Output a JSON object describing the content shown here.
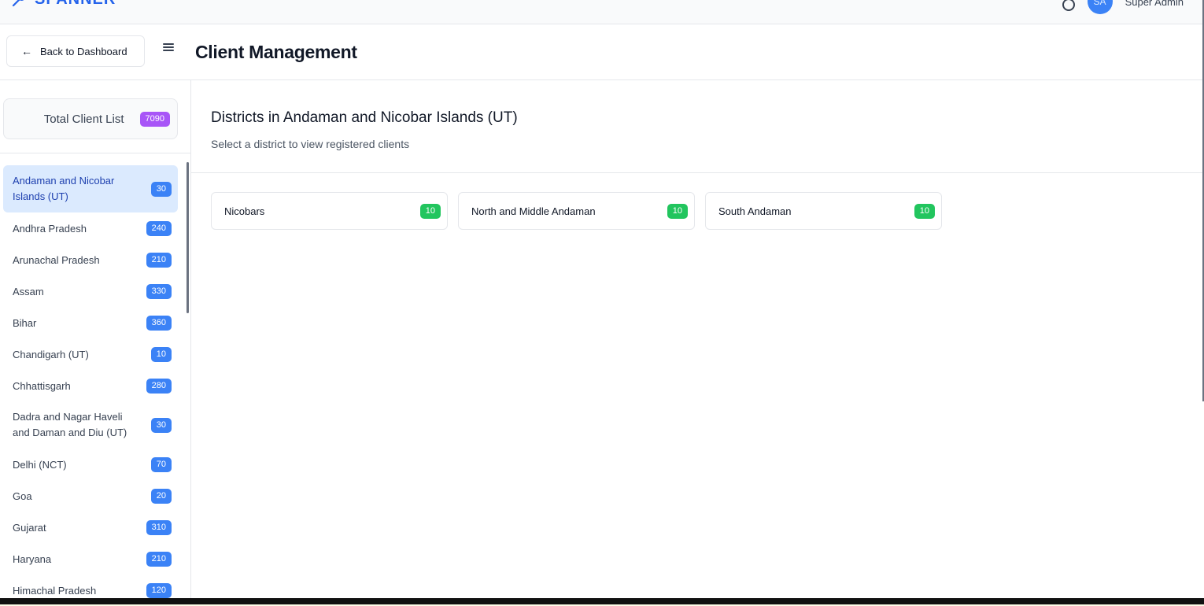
{
  "app": {
    "brand": "SPANNER",
    "user_initials": "SA",
    "user_name": "Super Admin"
  },
  "header": {
    "back_label": "Back to Dashboard",
    "title": "Client Management"
  },
  "sidebar": {
    "total_label": "Total Client List",
    "total_count": "7090",
    "states": [
      {
        "name": "Andaman and Nicobar Islands (UT)",
        "count": "30",
        "active": true
      },
      {
        "name": "Andhra Pradesh",
        "count": "240"
      },
      {
        "name": "Arunachal Pradesh",
        "count": "210"
      },
      {
        "name": "Assam",
        "count": "330"
      },
      {
        "name": "Bihar",
        "count": "360"
      },
      {
        "name": "Chandigarh (UT)",
        "count": "10"
      },
      {
        "name": "Chhattisgarh",
        "count": "280"
      },
      {
        "name": "Dadra and Nagar Haveli and Daman and Diu (UT)",
        "count": "30"
      },
      {
        "name": "Delhi (NCT)",
        "count": "70"
      },
      {
        "name": "Goa",
        "count": "20"
      },
      {
        "name": "Gujarat",
        "count": "310"
      },
      {
        "name": "Haryana",
        "count": "210"
      },
      {
        "name": "Himachal Pradesh",
        "count": "120"
      }
    ]
  },
  "main": {
    "title": "Districts in Andaman and Nicobar Islands (UT)",
    "subtitle": "Select a district to view registered clients",
    "districts": [
      {
        "name": "Nicobars",
        "count": "10"
      },
      {
        "name": "North and Middle Andaman",
        "count": "10"
      },
      {
        "name": "South Andaman",
        "count": "10"
      }
    ]
  },
  "colors": {
    "brand": "#2563eb",
    "total_badge": "#a855f7",
    "state_badge": "#3b82f6",
    "district_badge": "#22c55e",
    "active_item": "#dbeafe"
  }
}
